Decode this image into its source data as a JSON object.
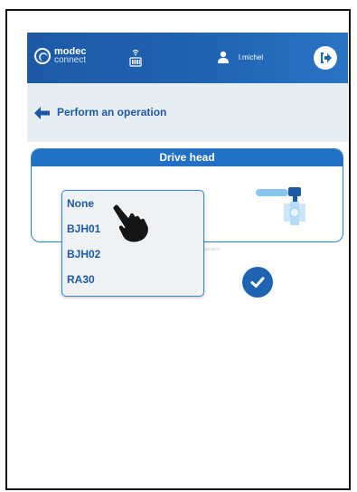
{
  "header": {
    "logo_line1": "modec",
    "logo_line2": "connect",
    "username": "l.michel"
  },
  "subheader": {
    "title": "Perform an operation"
  },
  "card": {
    "title": "Drive head"
  },
  "hint": "he operation",
  "dropdown": {
    "options": [
      "None",
      "BJH01",
      "BJH02",
      "RA30"
    ]
  },
  "icons": {
    "logo": "modec-logo-icon",
    "signal": "signal-icon",
    "user": "user-icon",
    "logout": "logout-icon",
    "back": "back-arrow-icon",
    "valve": "valve-icon",
    "confirm": "check-icon",
    "cursor": "hand-pointer-icon"
  },
  "colors": {
    "primary": "#1f63b3",
    "subheader_bg": "#e6edf3",
    "option_text": "#1d5aa6"
  }
}
